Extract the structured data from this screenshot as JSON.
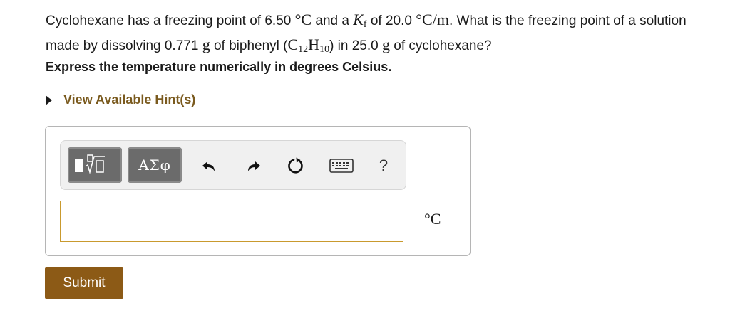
{
  "question": {
    "p1": "Cyclohexane has a freezing point of 6.50 ",
    "deg_c": "°C",
    "p2": " and a ",
    "kf_var": "K",
    "kf_sub": "f",
    "p3": " of 20.0 ",
    "kf_unit": "°C/m",
    "p4": ". What is the freezing point of a solution made by dissolving 0.771 ",
    "g1": "g",
    "p5": " of biphenyl (",
    "c": "C",
    "c_sub": "12",
    "h": "H",
    "h_sub": "10",
    "p6": ") in 25.0 ",
    "g2": "g",
    "p7": " of cyclohexane?"
  },
  "instruction": "Express the temperature numerically in degrees Celsius.",
  "hint": {
    "label": "View Available Hint(s)"
  },
  "toolbar": {
    "templates_icon": "fraction-radical-template-icon",
    "greek_label": "ΑΣφ",
    "undo_icon": "undo-icon",
    "redo_icon": "redo-icon",
    "reset_icon": "reset-icon",
    "keyboard_icon": "keyboard-icon",
    "help_label": "?"
  },
  "answer": {
    "value": "",
    "unit": "°C"
  },
  "submit_label": "Submit"
}
